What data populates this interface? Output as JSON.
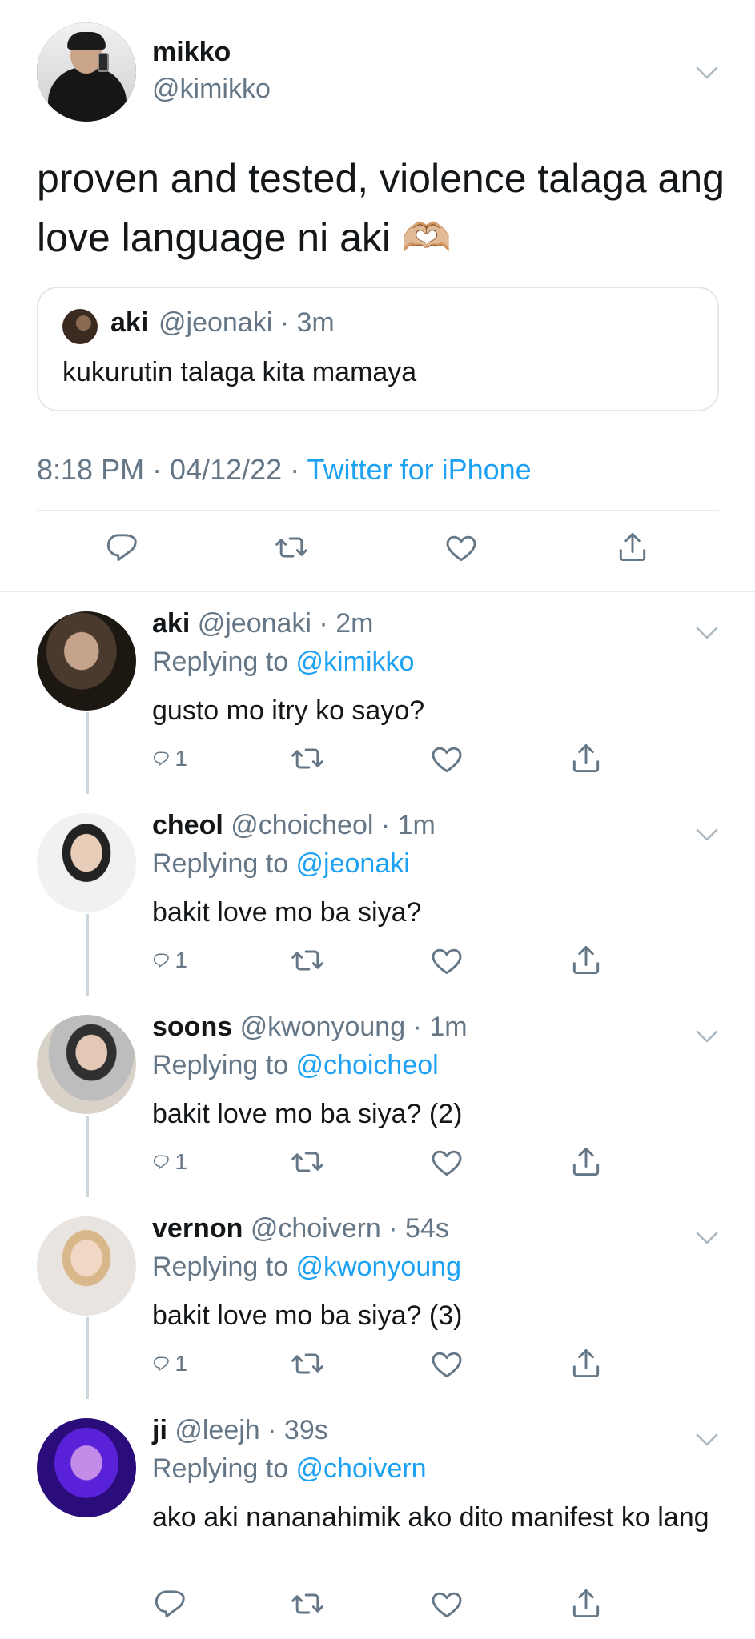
{
  "main_tweet": {
    "name": "mikko",
    "handle": "@kimikko",
    "text": "proven and tested, violence talaga ang love language ni aki 🫶🏼",
    "quote": {
      "name": "aki",
      "meta": "@jeonaki · 3m",
      "text": "kukurutin talaga kita mamaya"
    },
    "time": "8:18 PM · 04/12/22 · ",
    "source": "Twitter for iPhone"
  },
  "replies": [
    {
      "name": "aki",
      "meta": "@jeonaki · 2m",
      "replying_label": "Replying to ",
      "replying_to": "@kimikko",
      "text": "gusto mo itry ko sayo?",
      "reply_count": "1"
    },
    {
      "name": "cheol",
      "meta": "@choicheol · 1m",
      "replying_label": "Replying to ",
      "replying_to": "@jeonaki",
      "text": "bakit love mo ba siya?",
      "reply_count": "1"
    },
    {
      "name": "soons",
      "meta": "@kwonyoung · 1m",
      "replying_label": "Replying to ",
      "replying_to": "@choicheol",
      "text": "bakit love mo ba siya? (2)",
      "reply_count": "1"
    },
    {
      "name": "vernon",
      "meta": "@choivern · 54s",
      "replying_label": "Replying to ",
      "replying_to": "@kwonyoung",
      "text": "bakit love mo ba siya? (3)",
      "reply_count": "1"
    },
    {
      "name": "ji",
      "meta": "@leejh · 39s",
      "replying_label": "Replying to ",
      "replying_to": "@choivern",
      "text": "ako aki nananahimik ako dito manifest ko lang",
      "reply_count": ""
    }
  ],
  "colors": {
    "link": "#1da1f2",
    "secondary": "#657786",
    "divider": "#e6ecf0"
  },
  "icons": [
    "reply-icon",
    "retweet-icon",
    "like-icon",
    "share-icon",
    "chevron-down-icon"
  ]
}
